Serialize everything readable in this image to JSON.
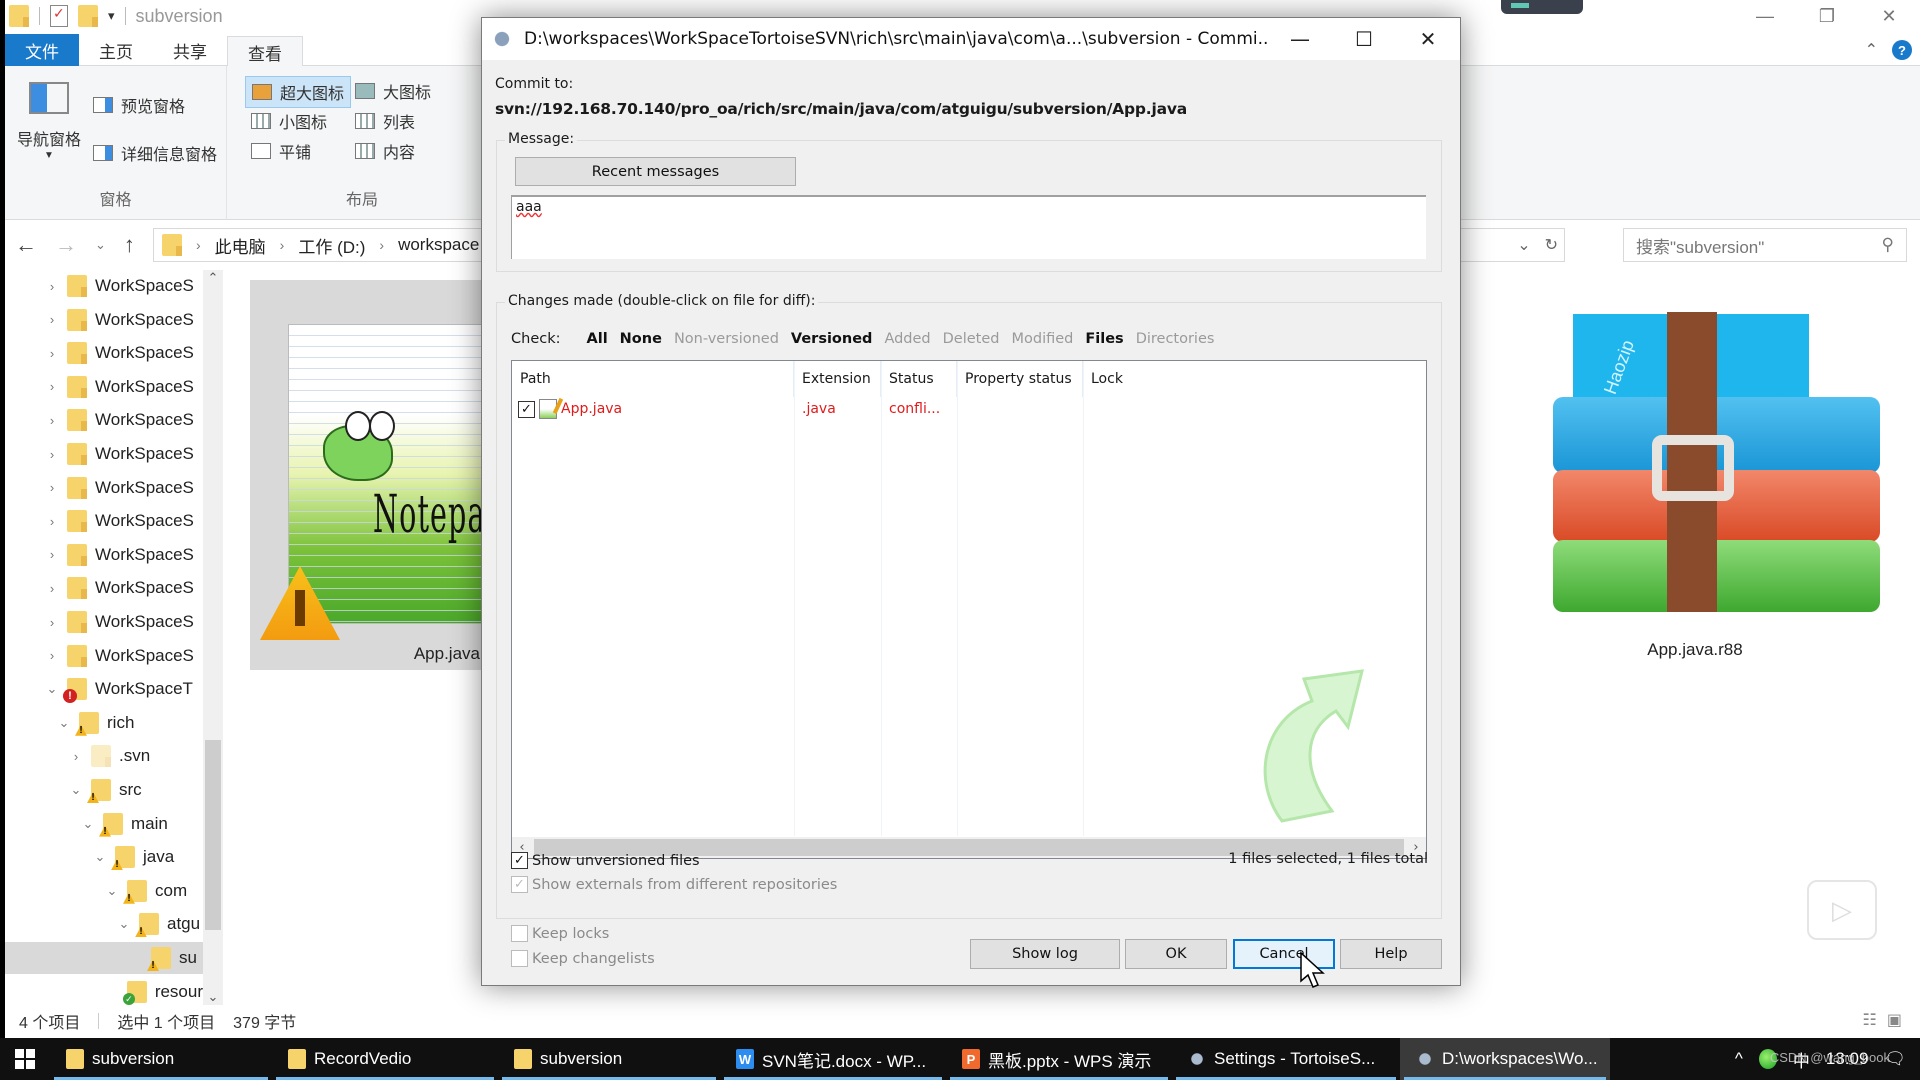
{
  "explorer": {
    "title": "subversion",
    "ribbon_tabs": [
      "文件",
      "主页",
      "共享",
      "查看"
    ],
    "active_tab": "查看",
    "panes_group": {
      "label": "窗格",
      "nav_pane": "导航窗格",
      "preview_pane": "预览窗格",
      "details_pane": "详细信息窗格"
    },
    "layout_group": {
      "label": "布局",
      "options": [
        "超大图标",
        "大图标",
        "小图标",
        "列表",
        "平铺",
        "内容"
      ],
      "selected": "超大图标"
    },
    "breadcrumb": [
      "此电脑",
      "工作 (D:)",
      "workspace"
    ],
    "search_placeholder": "搜索\"subversion\"",
    "tree": [
      {
        "label": "WorkSpaceS",
        "depth": 0,
        "expanded": false,
        "overlay": "none"
      },
      {
        "label": "WorkSpaceS",
        "depth": 0,
        "expanded": false,
        "overlay": "none"
      },
      {
        "label": "WorkSpaceS",
        "depth": 0,
        "expanded": false,
        "overlay": "none"
      },
      {
        "label": "WorkSpaceS",
        "depth": 0,
        "expanded": false,
        "overlay": "none"
      },
      {
        "label": "WorkSpaceS",
        "depth": 0,
        "expanded": false,
        "overlay": "none"
      },
      {
        "label": "WorkSpaceS",
        "depth": 0,
        "expanded": false,
        "overlay": "none"
      },
      {
        "label": "WorkSpaceS",
        "depth": 0,
        "expanded": false,
        "overlay": "none"
      },
      {
        "label": "WorkSpaceS",
        "depth": 0,
        "expanded": false,
        "overlay": "none"
      },
      {
        "label": "WorkSpaceS",
        "depth": 0,
        "expanded": false,
        "overlay": "none"
      },
      {
        "label": "WorkSpaceS",
        "depth": 0,
        "expanded": false,
        "overlay": "none"
      },
      {
        "label": "WorkSpaceS",
        "depth": 0,
        "expanded": false,
        "overlay": "none"
      },
      {
        "label": "WorkSpaceS",
        "depth": 0,
        "expanded": false,
        "overlay": "none"
      },
      {
        "label": "WorkSpaceT",
        "depth": 0,
        "expanded": true,
        "overlay": "conflict"
      },
      {
        "label": "rich",
        "depth": 1,
        "expanded": true,
        "overlay": "modified"
      },
      {
        "label": ".svn",
        "depth": 2,
        "expanded": false,
        "overlay": "hidden"
      },
      {
        "label": "src",
        "depth": 2,
        "expanded": true,
        "overlay": "modified"
      },
      {
        "label": "main",
        "depth": 3,
        "expanded": true,
        "overlay": "modified"
      },
      {
        "label": "java",
        "depth": 4,
        "expanded": true,
        "overlay": "modified"
      },
      {
        "label": "com",
        "depth": 5,
        "expanded": true,
        "overlay": "modified"
      },
      {
        "label": "atgu",
        "depth": 6,
        "expanded": true,
        "overlay": "modified"
      },
      {
        "label": "su",
        "depth": 7,
        "expanded": null,
        "overlay": "modified",
        "selected": true
      },
      {
        "label": "resour",
        "depth": 5,
        "expanded": null,
        "overlay": "normal"
      }
    ],
    "files": [
      {
        "name": "App.java",
        "icon": "notepad-plus-plus",
        "overlay": "modified"
      },
      {
        "name": "App.java.r88",
        "icon": "haozip-archive"
      }
    ],
    "haozip_text": "Haozip",
    "status": {
      "item_count": "4 个项目",
      "selection": "选中 1 个项目",
      "size": "379 字节"
    }
  },
  "dialog": {
    "title": "D:\\workspaces\\WorkSpaceTortoiseSVN\\rich\\src\\main\\java\\com\\a...\\subversion - Commi...",
    "commit_to_label": "Commit to:",
    "commit_url": "svn://192.168.70.140/pro_oa/rich/src/main/java/com/atguigu/subversion/App.java",
    "message_label": "Message:",
    "recent_messages_button": "Recent messages",
    "message_text": "aaa",
    "changes_label": "Changes made (double-click on file for diff):",
    "check_label": "Check:",
    "check_filters": [
      {
        "label": "All",
        "enabled": true
      },
      {
        "label": "None",
        "enabled": true
      },
      {
        "label": "Non-versioned",
        "enabled": false
      },
      {
        "label": "Versioned",
        "enabled": true
      },
      {
        "label": "Added",
        "enabled": false
      },
      {
        "label": "Deleted",
        "enabled": false
      },
      {
        "label": "Modified",
        "enabled": false
      },
      {
        "label": "Files",
        "enabled": true
      },
      {
        "label": "Directories",
        "enabled": false
      }
    ],
    "columns": [
      "Path",
      "Extension",
      "Status",
      "Property status",
      "Lock"
    ],
    "rows": [
      {
        "checked": true,
        "path": "App.java",
        "extension": ".java",
        "status": "confli...",
        "property_status": "",
        "lock": ""
      }
    ],
    "show_unversioned": {
      "label": "Show unversioned files",
      "checked": true
    },
    "show_externals": {
      "label": "Show externals from different repositories",
      "checked": true,
      "enabled": false
    },
    "selection_summary": "1 files selected, 1 files total",
    "keep_locks": {
      "label": "Keep locks",
      "checked": false,
      "enabled": false
    },
    "keep_changelists": {
      "label": "Keep changelists",
      "checked": false,
      "enabled": false
    },
    "buttons": {
      "show_log": "Show log",
      "ok": "OK",
      "cancel": "Cancel",
      "help": "Help"
    },
    "focused_button": "Cancel"
  },
  "taskbar": {
    "items": [
      {
        "label": "subversion",
        "icon": "folder"
      },
      {
        "label": "RecordVedio",
        "icon": "folder"
      },
      {
        "label": "subversion",
        "icon": "folder"
      },
      {
        "label": "SVN笔记.docx - WP...",
        "icon": "wps-writer"
      },
      {
        "label": "黑板.pptx - WPS 演示",
        "icon": "wps-presentation"
      },
      {
        "label": "Settings - TortoiseS...",
        "icon": "tortoisesvn"
      },
      {
        "label": "D:\\workspaces\\Wo...",
        "icon": "tortoisesvn",
        "active": true
      }
    ],
    "ime": "中",
    "clock": "13:09"
  },
  "watermark": "CSDN @wang_book"
}
